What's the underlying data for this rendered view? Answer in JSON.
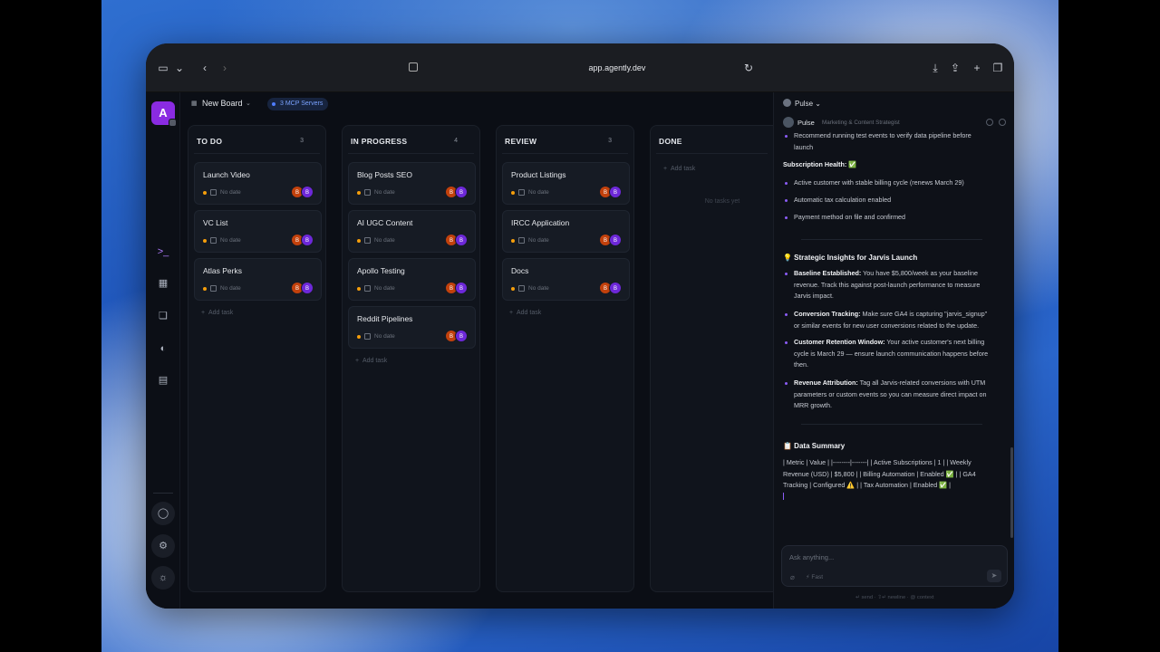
{
  "browser": {
    "url": "app.agently.dev"
  },
  "rail": {
    "logo": "A"
  },
  "board": {
    "name": "New Board",
    "mcp_badge": "3 MCP Servers",
    "add_task": "Add task",
    "columns": [
      {
        "title": "TO DO",
        "count": "3",
        "cards": [
          {
            "title": "Launch Video",
            "date": "No date"
          },
          {
            "title": "VC List",
            "date": "No date"
          },
          {
            "title": "Atlas Perks",
            "date": "No date"
          }
        ]
      },
      {
        "title": "IN PROGRESS",
        "count": "4",
        "cards": [
          {
            "title": "Blog Posts SEO",
            "date": "No date"
          },
          {
            "title": "AI UGC Content",
            "date": "No date"
          },
          {
            "title": "Apollo Testing",
            "date": "No date"
          },
          {
            "title": "Reddit Pipelines",
            "date": "No date"
          }
        ]
      },
      {
        "title": "REVIEW",
        "count": "3",
        "cards": [
          {
            "title": "Product Listings",
            "date": "No date"
          },
          {
            "title": "IRCC Application",
            "date": "No date"
          },
          {
            "title": "Docs",
            "date": "No date"
          }
        ]
      },
      {
        "title": "DONE",
        "count": "",
        "empty": "No tasks yet",
        "cards": []
      }
    ],
    "avatar_initial": "B"
  },
  "panel": {
    "agent_select": "Pulse",
    "agent_name": "Pulse",
    "agent_role": "Marketing & Content Strategist",
    "chat": {
      "l1": "Recommend running test events to verify data pipeline before",
      "l2": "launch",
      "sub_head": "Subscription Health: ✅",
      "sub_b1": "Active customer with stable billing cycle (renews March 29)",
      "sub_b2": "Automatic tax calculation enabled",
      "sub_b3": "Payment method on file and confirmed",
      "insights_head": "💡 Strategic Insights for Jarvis Launch",
      "i1_label": "Baseline Established:",
      "i1_a": " You have $5,800/week as your baseline",
      "i1_b": "revenue. Track this against post-launch performance to measure",
      "i1_c": "Jarvis impact.",
      "i2_label": "Conversion Tracking:",
      "i2_a": " Make sure GA4 is capturing \"jarvis_signup\"",
      "i2_b": "or similar events for new user conversions related to the update.",
      "i3_label": "Customer Retention Window:",
      "i3_a": " Your active customer's next billing",
      "i3_b": "cycle is March 29 — ensure launch communication happens before",
      "i3_c": "then.",
      "i4_label": "Revenue Attribution:",
      "i4_a": " Tag all Jarvis-related conversions with UTM",
      "i4_b": "parameters or custom events so you can measure direct impact on",
      "i4_c": "MRR growth.",
      "summary_head": "📋 Data Summary",
      "s1": "| Metric | Value | |--------|-------| | Active Subscriptions | 1 | | Weekly",
      "s2": "Revenue (USD) | $5,800 | | Billing Automation | Enabled ✅ | | GA4",
      "s3": "Tracking | Configured ⚠️ | | Tax Automation | Enabled ✅ |"
    },
    "input_placeholder": "Ask anything...",
    "fast_label": "Fast",
    "hint": "↵ send · ⇧↵ newline · @ context"
  }
}
